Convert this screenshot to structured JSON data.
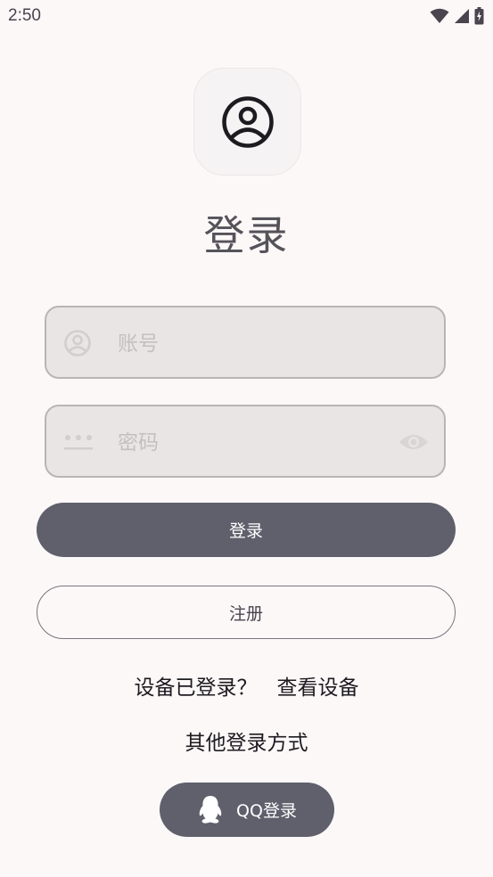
{
  "status_bar": {
    "time": "2:50"
  },
  "header": {
    "avatar_icon": "account-circle-icon",
    "title": "登录"
  },
  "form": {
    "account": {
      "placeholder": "账号",
      "icon": "account-circle-icon"
    },
    "password": {
      "placeholder": "密码",
      "icon": "password-dots-icon",
      "toggle_icon": "eye-icon"
    }
  },
  "actions": {
    "login_label": "登录",
    "register_label": "注册"
  },
  "device": {
    "question": "设备已登录？",
    "link": "查看设备"
  },
  "other": {
    "label": "其他登录方式",
    "qq_label": "QQ登录",
    "qq_icon": "qq-penguin-icon"
  },
  "colors": {
    "background": "#fcf8f8",
    "primary_button": "#5f606c",
    "field_background": "#e9e5e5",
    "field_border": "#b9b5b5"
  }
}
